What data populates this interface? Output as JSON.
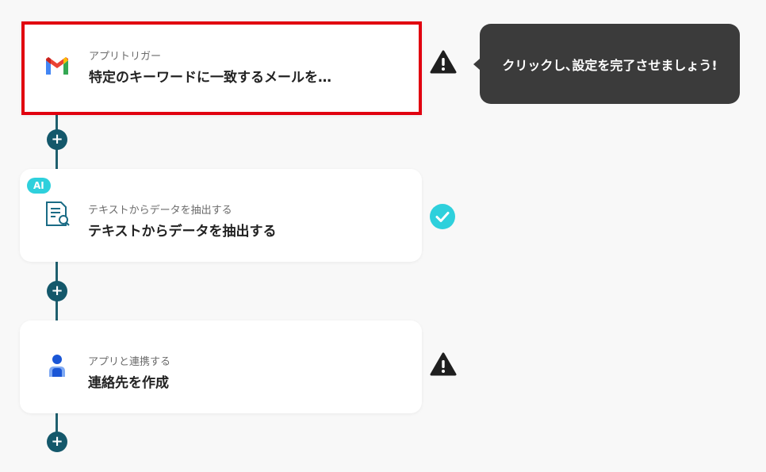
{
  "steps": [
    {
      "kind": "アプリトリガー",
      "title": "特定のキーワードに一致するメールを…",
      "icon": "gmail-icon",
      "status": "warning",
      "selected": true
    },
    {
      "kind": "テキストからデータを抽出する",
      "title": "テキストからデータを抽出する",
      "icon": "document-search-icon",
      "status": "done",
      "badge": "AI"
    },
    {
      "kind": "アプリと連携する",
      "title": "連絡先を作成",
      "icon": "person-icon",
      "status": "warning"
    }
  ],
  "tooltip": {
    "text": "クリックし､設定を完了させましょう!"
  },
  "add_step_label": "+",
  "colors": {
    "accent": "#14586b",
    "selection": "#e1000f",
    "success": "#2ed0dc",
    "tooltip_bg": "#3b3b3b"
  }
}
